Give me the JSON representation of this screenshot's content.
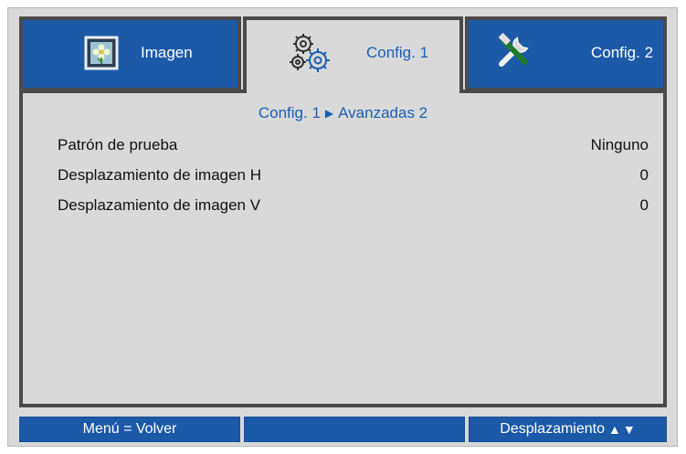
{
  "tabs": [
    {
      "label": "Imagen",
      "icon": "flower-image-icon",
      "active": false
    },
    {
      "label": "Config. 1",
      "icon": "gears-icon",
      "active": true
    },
    {
      "label": "Config. 2",
      "icon": "tools-icon",
      "active": false
    }
  ],
  "breadcrumb": {
    "parent": "Config. 1",
    "separator_icon": "triangle-right-icon",
    "current": "Avanzadas 2"
  },
  "settings": [
    {
      "label": "Patrón de prueba",
      "value": "Ninguno"
    },
    {
      "label": "Desplazamiento de imagen H",
      "value": "0"
    },
    {
      "label": "Desplazamiento de imagen V",
      "value": "0"
    }
  ],
  "bottom_bar": {
    "back": "Menú = Volver",
    "middle": "",
    "scroll": "Desplazamiento",
    "scroll_icons": [
      "arrow-up-icon",
      "arrow-down-icon"
    ]
  },
  "colors": {
    "accent": "#1c5aa8",
    "active_text": "#1b5fb3",
    "panel": "#d9d9d9",
    "border": "#4a4a4a"
  }
}
